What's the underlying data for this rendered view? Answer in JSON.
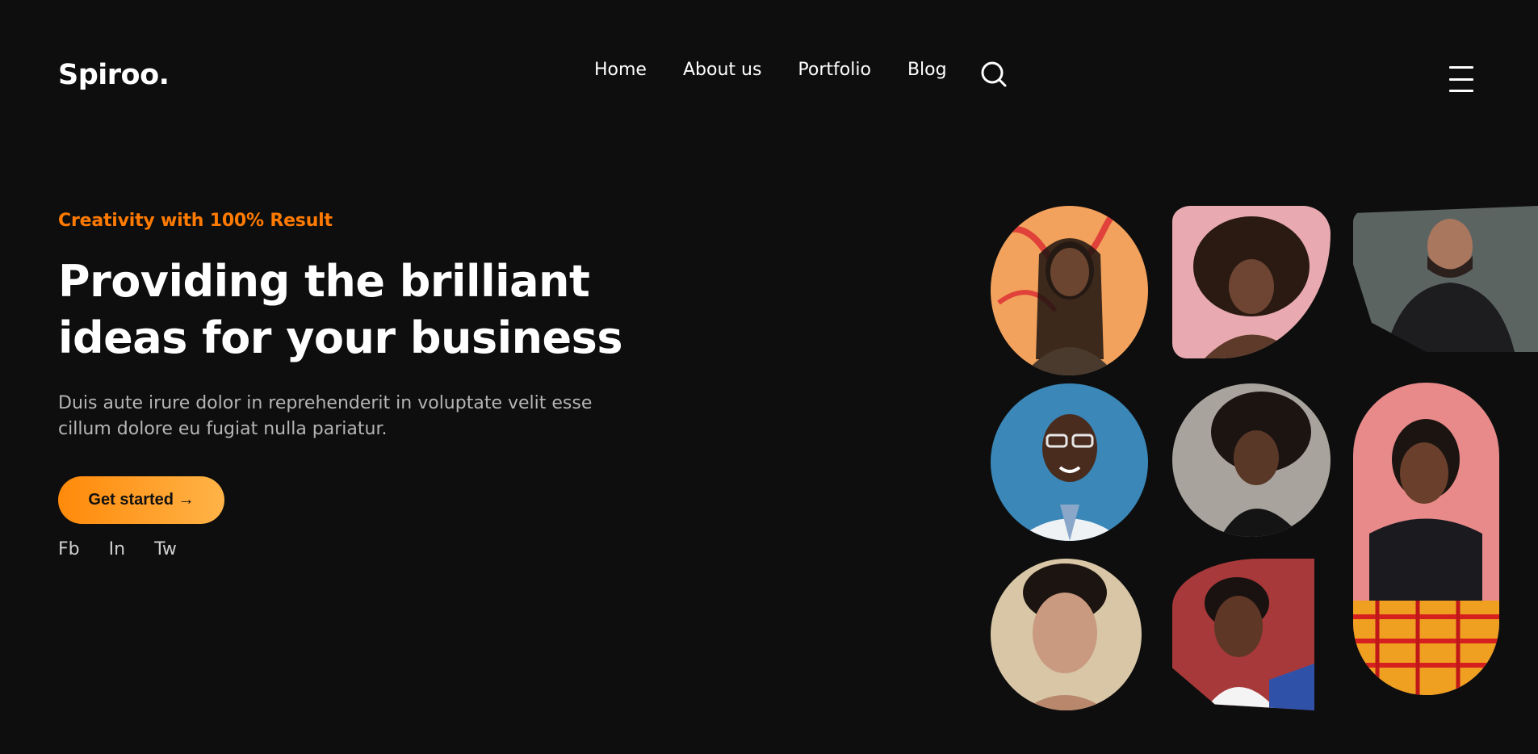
{
  "brand": {
    "logo": "Spiroo."
  },
  "nav": {
    "items": [
      "Home",
      "About us",
      "Portfolio",
      "Blog"
    ]
  },
  "hero": {
    "eyebrow": "Creativity with 100% Result",
    "headline_line1": "Providing the brilliant",
    "headline_line2": "ideas for your business",
    "description_line1": "Duis aute irure dolor in reprehenderit in voluptate velit esse",
    "description_line2": "cillum dolore eu fugiat nulla pariatur.",
    "cta_label": "Get started →"
  },
  "social": [
    "Fb",
    "In",
    "Tw"
  ],
  "colors": {
    "background": "#0e0e0e",
    "accent": "#ff7a00",
    "accent_gradient_end": "#ffb347",
    "text": "#ffffff",
    "muted": "#b5b5b5"
  },
  "icons": {
    "search": "search-icon",
    "menu": "hamburger-menu-icon"
  }
}
